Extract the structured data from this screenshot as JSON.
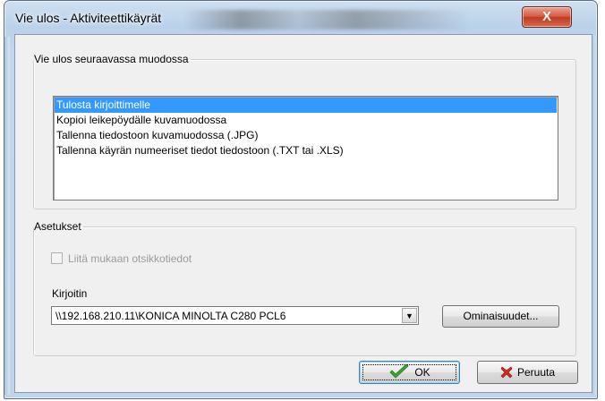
{
  "window": {
    "title": "Vie ulos - Aktiviteettikäyrät",
    "close_label": "X"
  },
  "export_group": {
    "legend": "Vie ulos seuraavassa muodossa",
    "items": [
      {
        "label": "Tulosta kirjoittimelle",
        "selected": true
      },
      {
        "label": "Kopioi leikepöydälle kuvamuodossa",
        "selected": false
      },
      {
        "label": "Tallenna tiedostoon kuvamuodossa (.JPG)",
        "selected": false
      },
      {
        "label": "Tallenna käyrän numeeriset tiedot tiedostoon (.TXT tai .XLS)",
        "selected": false
      }
    ]
  },
  "settings_group": {
    "legend": "Asetukset",
    "checkbox_label": "Liitä mukaan otsikkotiedot",
    "checkbox_checked": false,
    "checkbox_enabled": false,
    "printer_label": "Kirjoitin",
    "printer_value": "\\\\192.168.210.11\\KONICA MINOLTA C280 PCL6",
    "properties_button": "Ominaisuudet..."
  },
  "buttons": {
    "ok_label": "OK",
    "ok_icon": "checkmark-icon",
    "cancel_label": "Peruuta",
    "cancel_icon": "red-x-icon"
  },
  "colors": {
    "selection": "#3399ff",
    "close_button": "#c9452a"
  }
}
